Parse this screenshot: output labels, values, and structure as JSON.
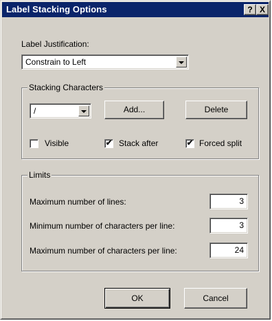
{
  "window": {
    "title": "Label Stacking Options"
  },
  "titlebar": {
    "help_label": "?",
    "close_label": "X"
  },
  "justification": {
    "label": "Label Justification:",
    "value": "Constrain to Left"
  },
  "stacking": {
    "title": "Stacking Characters",
    "char_value": "/",
    "add_label": "Add...",
    "delete_label": "Delete",
    "visible": {
      "label": "Visible",
      "checked": false
    },
    "stack_after": {
      "label": "Stack after",
      "checked": true
    },
    "forced_split": {
      "label": "Forced split",
      "checked": true
    }
  },
  "limits": {
    "title": "Limits",
    "max_lines": {
      "label": "Maximum number of lines:",
      "value": "3"
    },
    "min_chars": {
      "label": "Minimum number of characters per line:",
      "value": "3"
    },
    "max_chars": {
      "label": "Maximum number of characters per line:",
      "value": "24"
    }
  },
  "footer": {
    "ok_label": "OK",
    "cancel_label": "Cancel"
  },
  "colors": {
    "titlebar": "#0a246a",
    "face": "#d4d0c8"
  },
  "check_glyph": "✔"
}
